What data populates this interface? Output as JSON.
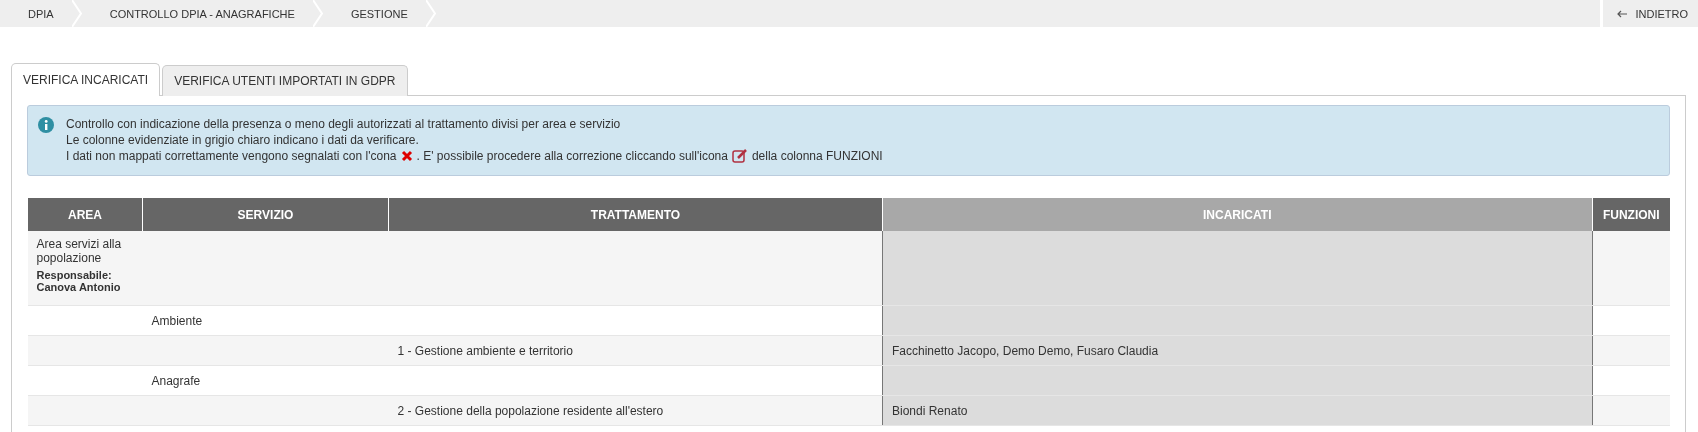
{
  "breadcrumb": [
    "DPIA",
    "CONTROLLO DPIA - ANAGRAFICHE",
    "GESTIONE"
  ],
  "back_button": {
    "label": "INDIETRO"
  },
  "tabs": [
    {
      "label": "VERIFICA INCARICATI",
      "selected": true
    },
    {
      "label": "VERIFICA UTENTI IMPORTATI IN GDPR",
      "selected": false
    }
  ],
  "info": {
    "lines": [
      "Controllo con indicazione della presenza o meno degli autorizzati al trattamento divisi per area e servizio",
      "Le colonne evidenziate in grigio chiaro indicano i dati da verificare."
    ],
    "last_line": [
      "I dati non mappati correttamente vengono segnalati con l'cona",
      ". E' possibile procedere alla correzione cliccando sull'icona",
      "della colonna FUNZIONI"
    ]
  },
  "table": {
    "columns": [
      {
        "label": "AREA",
        "highlighted": false
      },
      {
        "label": "SERVIZIO",
        "highlighted": false
      },
      {
        "label": "TRATTAMENTO",
        "highlighted": false
      },
      {
        "label": "INCARICATI",
        "highlighted": true
      },
      {
        "label": "FUNZIONI",
        "highlighted": false
      }
    ],
    "rows": [
      {
        "kind": "area",
        "area": "Area servizi alla popolazione",
        "responsabile_label": "Responsabile:",
        "responsabile": "Canova Antonio"
      },
      {
        "kind": "servizio",
        "servizio": "Ambiente"
      },
      {
        "kind": "trattamento",
        "trattamento": "1 - Gestione ambiente e territorio",
        "incaricati": "Facchinetto Jacopo, Demo Demo, Fusaro Claudia"
      },
      {
        "kind": "servizio",
        "servizio": "Anagrafe"
      },
      {
        "kind": "trattamento",
        "trattamento": "2 - Gestione della popolazione residente all'estero",
        "incaricati": "Biondi Renato"
      }
    ]
  }
}
